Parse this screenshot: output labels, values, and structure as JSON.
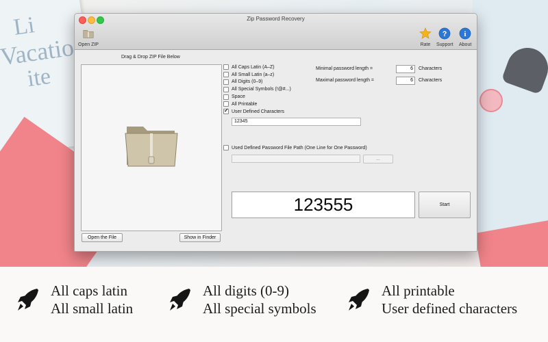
{
  "window": {
    "title": "Zip Password Recovery"
  },
  "toolbar": {
    "open_zip": "Open ZIP",
    "rate": "Rate",
    "support": "Support",
    "about": "About"
  },
  "drop": {
    "label": "Drag & Drop ZIP File Below",
    "open_file": "Open the File",
    "show_finder": "Show in Finder"
  },
  "charsets": [
    {
      "label": "All Caps Latin (A–Z)",
      "checked": false
    },
    {
      "label": "All Small Latin (a–z)",
      "checked": false
    },
    {
      "label": "All Digits (0–9)",
      "checked": false
    },
    {
      "label": "All Special Symbols (!@#...)",
      "checked": false
    },
    {
      "label": "Space",
      "checked": false
    },
    {
      "label": "All Printable",
      "checked": false
    },
    {
      "label": "User Defined Characters",
      "checked": true
    }
  ],
  "user_chars": "12345",
  "length": {
    "min_label": "Minimal password length =",
    "min_value": "6",
    "max_label": "Maximal password length =",
    "max_value": "6",
    "unit": "Characters"
  },
  "file_option": {
    "label": "Used Defined Password File Path (One Line for One Password)",
    "checked": false,
    "browse": "..."
  },
  "result_value": "123555",
  "start_label": "Start",
  "features": [
    {
      "line1": "All caps latin",
      "line2": "All small latin"
    },
    {
      "line1": "All digits (0-9)",
      "line2": "All special symbols"
    },
    {
      "line1": "All printable",
      "line2": "User defined characters"
    }
  ],
  "colors": {
    "accent_pink": "#f0848a",
    "strip_bg": "#faf9f7"
  }
}
